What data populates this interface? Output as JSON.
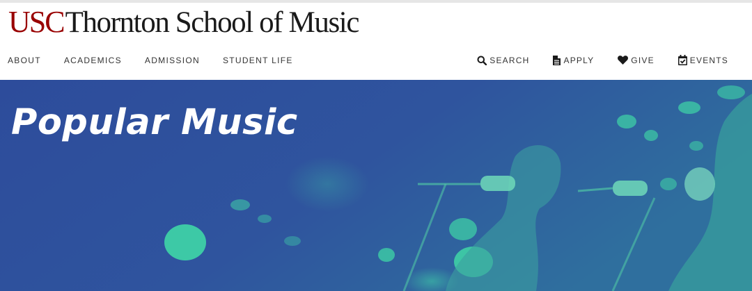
{
  "site": {
    "logo_usc": "USC",
    "logo_name": "Thornton School of Music"
  },
  "primary_nav": [
    {
      "label": "ABOUT"
    },
    {
      "label": "ACADEMICS"
    },
    {
      "label": "ADMISSION"
    },
    {
      "label": "STUDENT LIFE"
    }
  ],
  "utility_nav": {
    "search": {
      "label": "SEARCH",
      "icon": "search-icon"
    },
    "apply": {
      "label": "APPLY",
      "icon": "document-icon"
    },
    "give": {
      "label": "GIVE",
      "icon": "heart-icon"
    },
    "events": {
      "label": "EVENTS",
      "icon": "calendar-check-icon"
    }
  },
  "hero": {
    "title": "Popular Music"
  },
  "colors": {
    "brand_red": "#990000",
    "hero_blue": "#2e4f9c",
    "hero_accent": "#3fd6a6"
  }
}
